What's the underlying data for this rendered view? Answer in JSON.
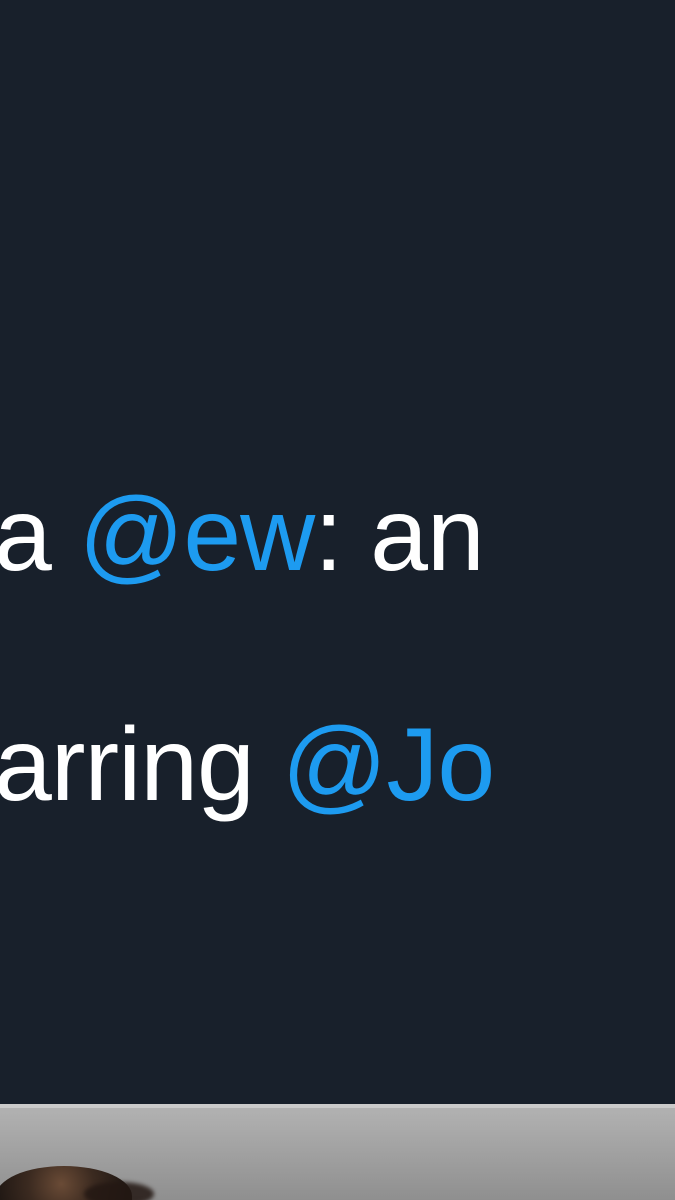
{
  "tweet": {
    "line_1": {
      "text_before": "a",
      "mention": "@ew",
      "text_after": ": an"
    },
    "line_2": {
      "text_before": "arring",
      "mention": "@Jo"
    }
  },
  "media": {
    "description": "photo thumbnail"
  },
  "colors": {
    "background": "#18202b",
    "text": "#ffffff",
    "mention": "#1d9bf0"
  }
}
